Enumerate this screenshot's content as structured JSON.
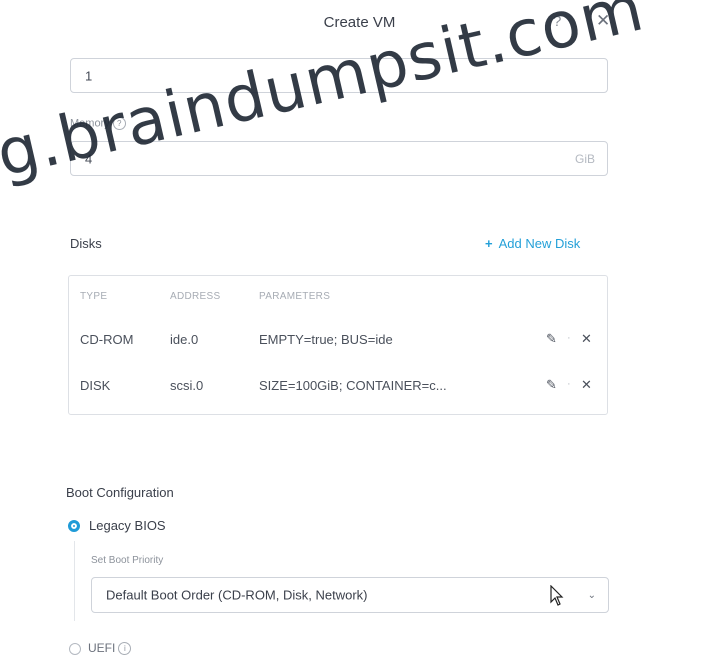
{
  "dialog": {
    "title": "Create VM"
  },
  "cpu": {
    "value": "1"
  },
  "memory": {
    "label": "Memory",
    "value": "4",
    "unit": "GiB"
  },
  "disks": {
    "title": "Disks",
    "add_label": "Add New Disk",
    "columns": [
      "TYPE",
      "ADDRESS",
      "PARAMETERS"
    ],
    "rows": [
      {
        "type": "CD-ROM",
        "address": "ide.0",
        "parameters": "EMPTY=true; BUS=ide"
      },
      {
        "type": "DISK",
        "address": "scsi.0",
        "parameters": "SIZE=100GiB; CONTAINER=c..."
      }
    ]
  },
  "boot": {
    "title": "Boot Configuration",
    "legacy_label": "Legacy BIOS",
    "priority_label": "Set Boot Priority",
    "priority_value": "Default Boot Order (CD-ROM, Disk, Network)",
    "uefi_label": "UEFI",
    "selected": "Legacy BIOS"
  },
  "watermark": "g.braindumpsit.com",
  "icons": [
    "help-icon",
    "close-icon",
    "info-icon",
    "plus-icon",
    "pencil-icon",
    "delete-icon",
    "chevron-down-icon",
    "cursor-icon"
  ],
  "colors": {
    "accent": "#1f9bd7",
    "link": "#24a0d8",
    "text": "#3d434f",
    "border": "#cfd3da"
  }
}
